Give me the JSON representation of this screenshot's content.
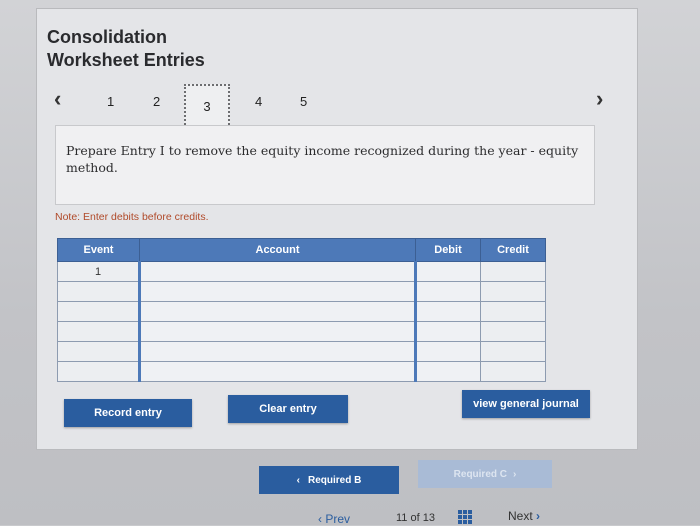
{
  "title_line1": "Consolidation",
  "title_line2": "Worksheet Entries",
  "pager": {
    "prev_icon": "chevron-left-icon",
    "next_icon": "chevron-right-icon",
    "pages": [
      "1",
      "2",
      "3",
      "4",
      "5"
    ],
    "active_page": "3"
  },
  "prompt": "Prepare Entry I to remove the equity income recognized during the year - equity method.",
  "note": "Note: Enter debits before credits.",
  "table": {
    "headers": [
      "Event",
      "Account",
      "Debit",
      "Credit"
    ],
    "rows": [
      {
        "event": "1"
      },
      {
        "event": ""
      },
      {
        "event": ""
      },
      {
        "event": ""
      },
      {
        "event": ""
      },
      {
        "event": ""
      }
    ]
  },
  "buttons": {
    "record": "Record entry",
    "clear": "Clear entry",
    "view": "view general journal"
  },
  "nav": {
    "required_prev": "Required B",
    "required_next": "Required C"
  },
  "footer": {
    "prev": "Prev",
    "page_of": "11 of 13",
    "next": "Next"
  },
  "colors": {
    "accent": "#2a5d9f",
    "header_blue": "#4d79b8",
    "note_red": "#b04a2a"
  }
}
